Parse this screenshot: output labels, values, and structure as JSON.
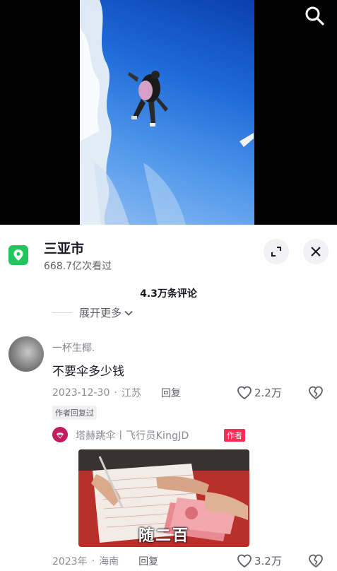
{
  "location": {
    "name": "三亚市",
    "views": "668.7亿次看过",
    "icon": "location-pin-icon",
    "accent": "#22c55e"
  },
  "comments_header": {
    "count": "4.3万条评论",
    "expand_label": "展开更多"
  },
  "comments": [
    {
      "user": "一杯生椰.",
      "text": "不要伞多少钱",
      "date": "2023-12-30",
      "region": "江苏",
      "reply_label": "回复",
      "likes": "2.2万",
      "author_replied": "作者回复过"
    }
  ],
  "reply": {
    "user": "塔赫跳伞丨飞行员KingJD",
    "badge": "作者",
    "badge_color": "#fe2c55",
    "image_caption": "随二百",
    "date": "2023年",
    "region": "海南",
    "reply_label": "回复",
    "likes": "3.2万"
  }
}
